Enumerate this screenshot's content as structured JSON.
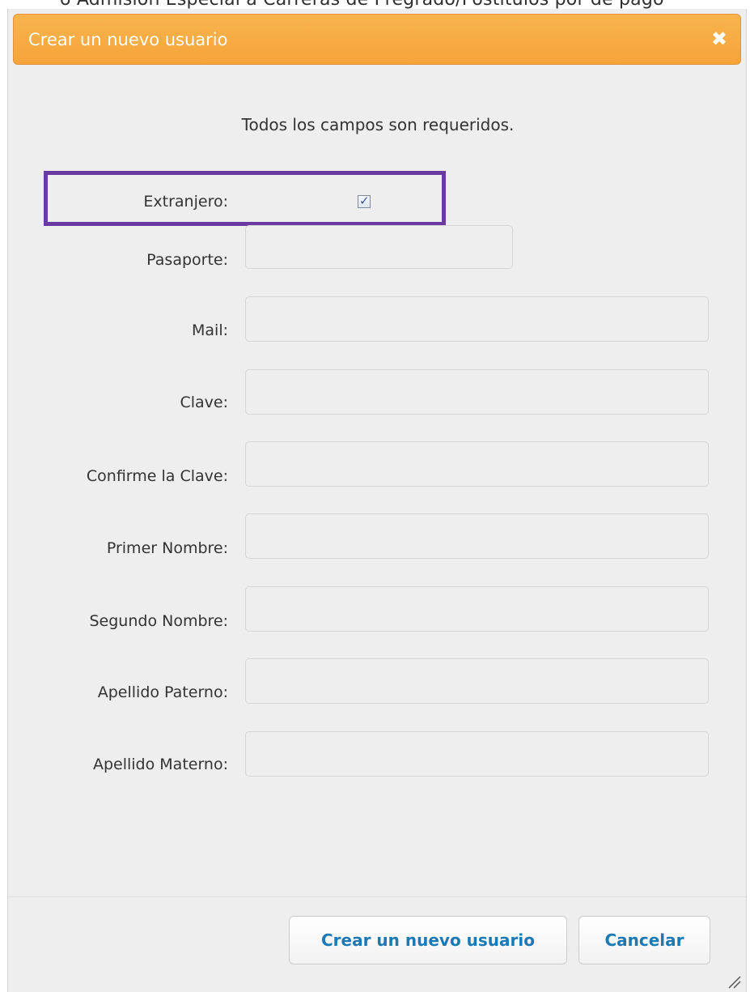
{
  "background": {
    "partial_text": "o Admisión Especial a Carreras de Pregrado/Postítulos por de pago"
  },
  "dialog": {
    "title": "Crear un nuevo usuario",
    "close_icon": "close-icon",
    "instructions": "Todos los campos son requeridos.",
    "accent_color": "#f5a43a",
    "highlight_color": "#6b3aa0"
  },
  "form": {
    "extranjero": {
      "label": "Extranjero:",
      "checked": true
    },
    "fields": [
      {
        "label": "Pasaporte:",
        "value": ""
      },
      {
        "label": "Mail:",
        "value": ""
      },
      {
        "label": "Clave:",
        "value": ""
      },
      {
        "label": "Confirme la Clave:",
        "value": ""
      },
      {
        "label": "Primer Nombre:",
        "value": ""
      },
      {
        "label": "Segundo Nombre:",
        "value": ""
      },
      {
        "label": "Apellido Paterno:",
        "value": ""
      },
      {
        "label": "Apellido Materno:",
        "value": ""
      }
    ]
  },
  "buttons": {
    "create_label": "Crear un nuevo usuario",
    "cancel_label": "Cancelar",
    "link_color": "#1b79b4"
  }
}
